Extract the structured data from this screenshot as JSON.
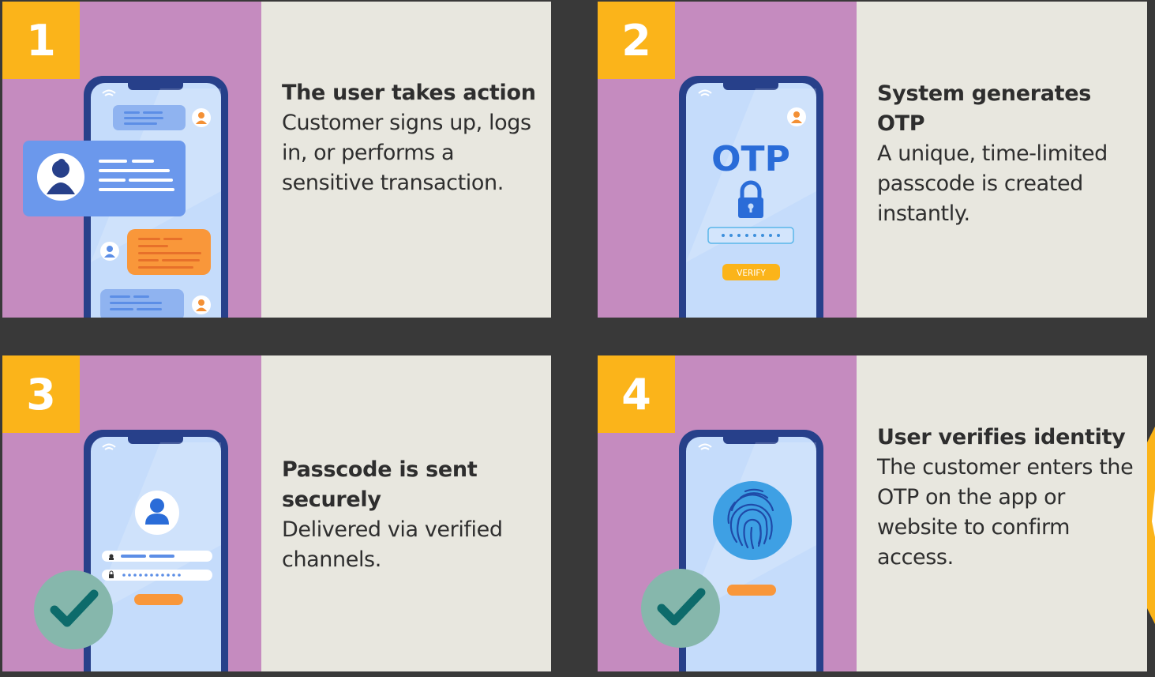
{
  "steps": [
    {
      "number": "1",
      "title": "The user takes action",
      "description": "Customer signs up, logs in, or performs a sensitive transaction."
    },
    {
      "number": "2",
      "title": "System generates OTP",
      "description": "A unique, time-limited passcode is created instantly.",
      "otp_label": "OTP",
      "verify_label": "VERIFY"
    },
    {
      "number": "3",
      "title": "Passcode is sent securely",
      "description": "Delivered via verified channels."
    },
    {
      "number": "4",
      "title": "User verifies identity",
      "description": "The customer enters the OTP on the app or website to confirm access."
    }
  ],
  "colors": {
    "background": "#393939",
    "card": "#e8e7df",
    "illustration_bg": "#c58bbf",
    "number_badge": "#fbb41a",
    "phone_frame": "#27408a",
    "phone_screen": "#c5dcfb",
    "accent_blue": "#2a6cd8",
    "accent_orange": "#f9973a",
    "check_circle": "#86b7ac",
    "check_mark": "#0d6b6b"
  },
  "icons": [
    "wifi-icon",
    "avatar-icon",
    "lock-icon",
    "fingerprint-icon",
    "check-icon",
    "user-icon"
  ]
}
